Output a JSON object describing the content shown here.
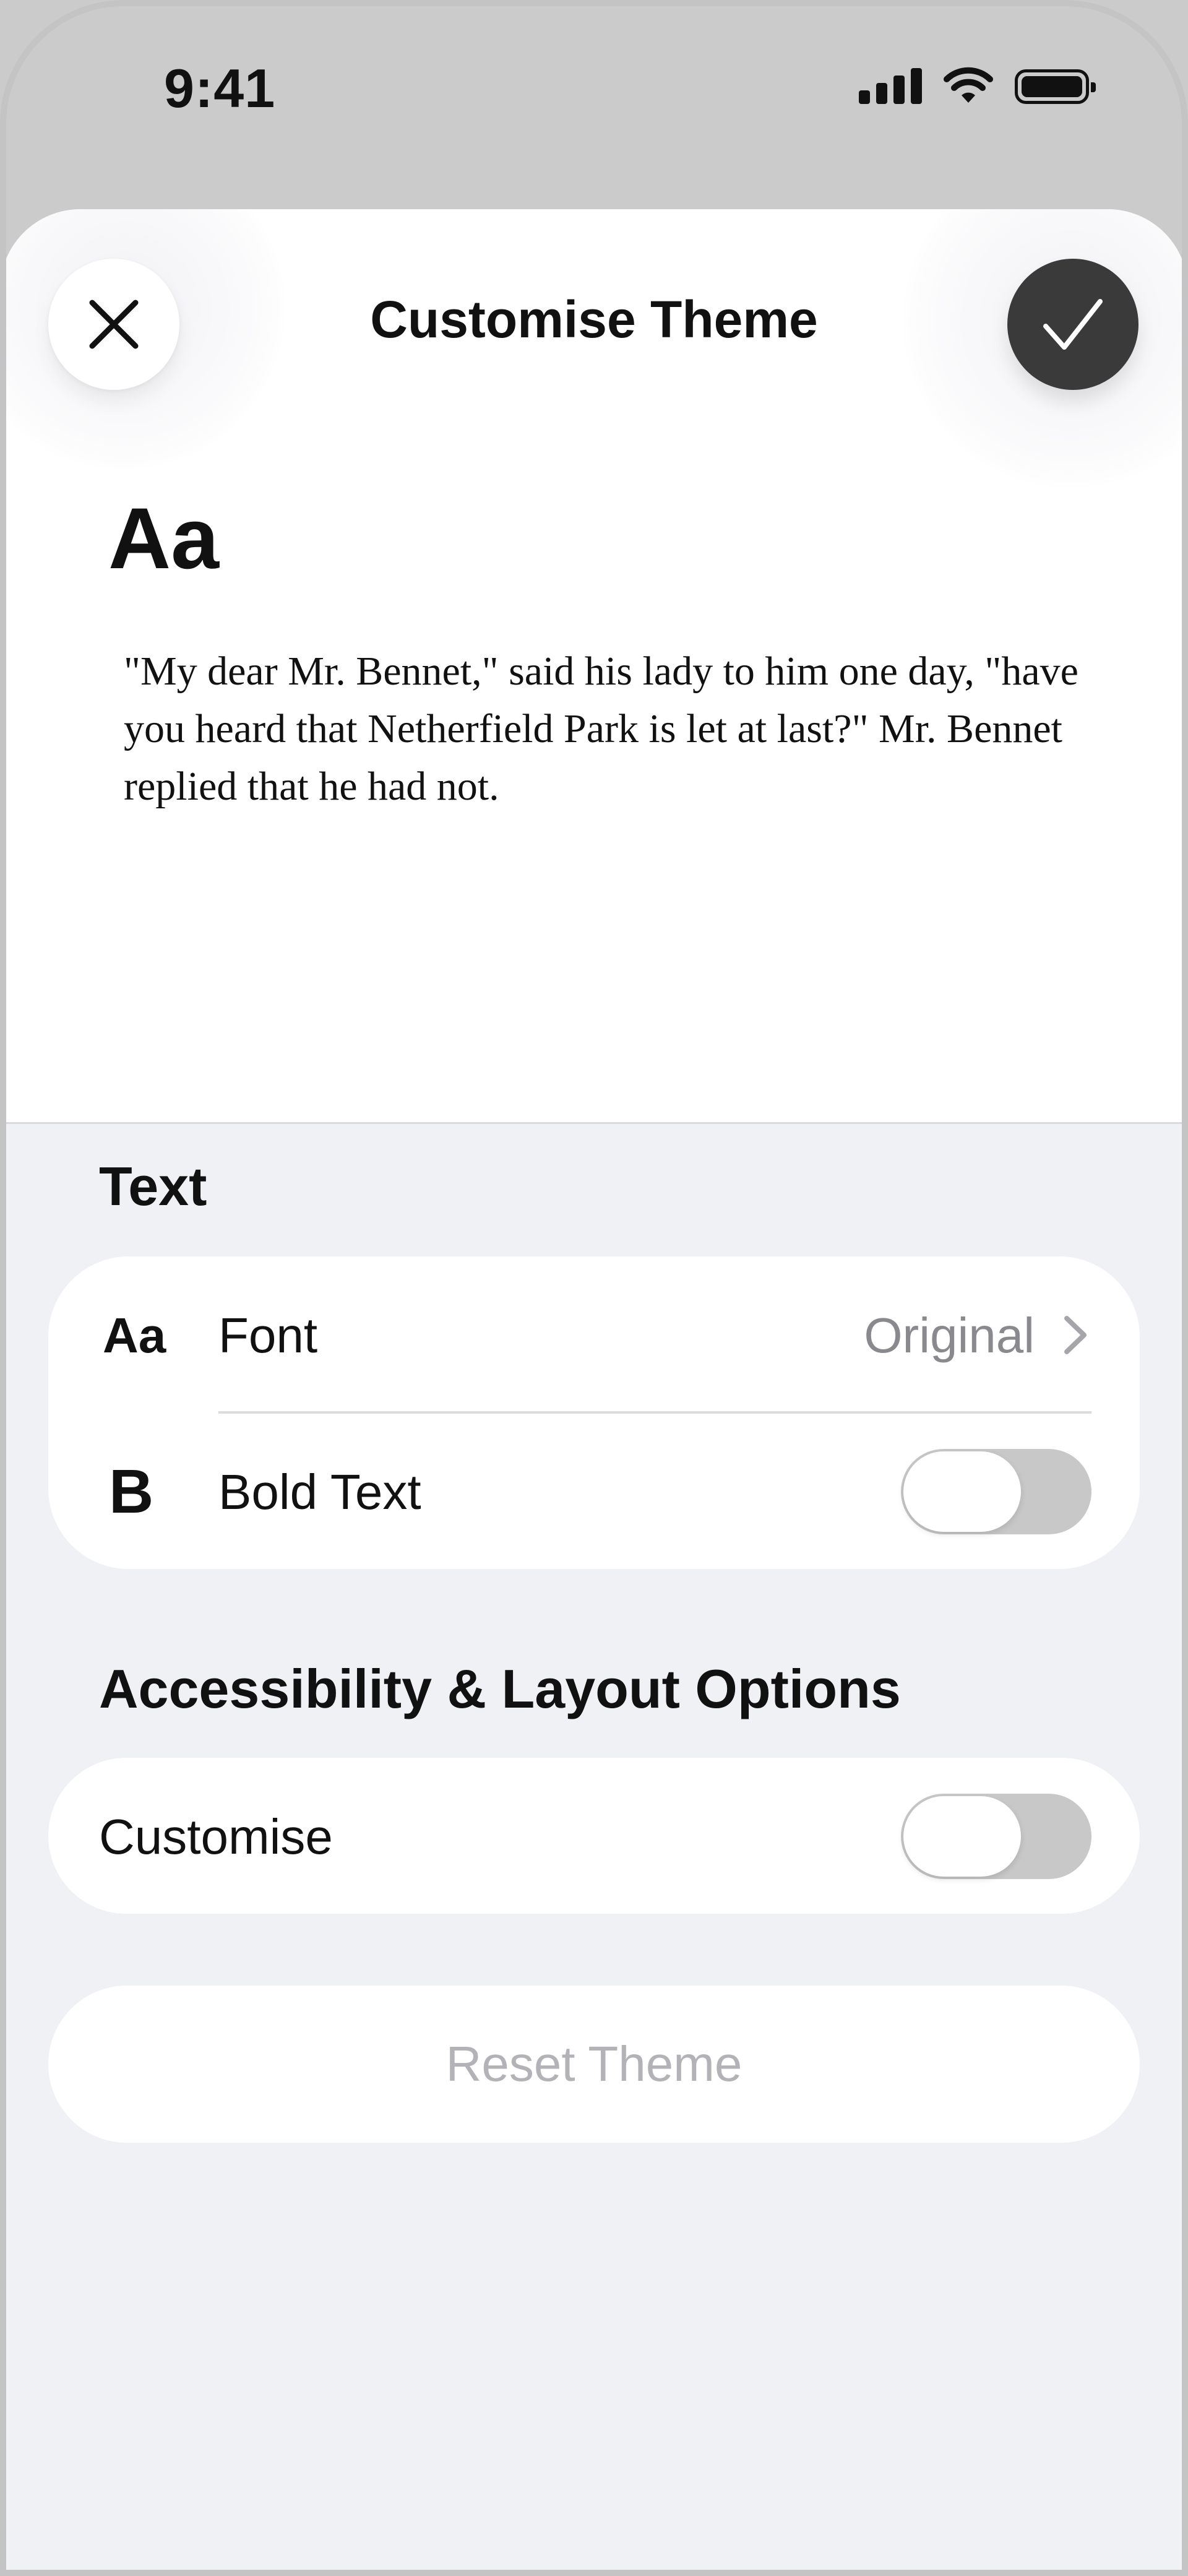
{
  "status_bar": {
    "time": "9:41",
    "icons": [
      "cellular-signal-icon",
      "wifi-icon",
      "battery-icon"
    ]
  },
  "sheet": {
    "title": "Customise Theme",
    "close_icon": "close-icon",
    "done_icon": "checkmark-icon"
  },
  "preview": {
    "sample_glyph": "Aa",
    "sample_text": "\"My dear Mr. Bennet,\" said his lady to him one day, \"have you heard that Netherfield Park is let at last?\" Mr. Bennet replied that he had not."
  },
  "text_section": {
    "heading": "Text",
    "font_row": {
      "icon": "Aa",
      "label": "Font",
      "value": "Original"
    },
    "bold_row": {
      "icon": "B",
      "label": "Bold Text",
      "enabled": false
    }
  },
  "accessibility_section": {
    "heading": "Accessibility & Layout Options",
    "customise_row": {
      "label": "Customise",
      "enabled": false
    }
  },
  "reset": {
    "label": "Reset Theme"
  },
  "colors": {
    "background": "#f0f1f5",
    "card": "#ffffff",
    "done_button": "#3a3a3a",
    "secondary_text": "#8a8a8e",
    "disabled_text": "#b3b3b7",
    "toggle_off": "#c8c8c8"
  }
}
